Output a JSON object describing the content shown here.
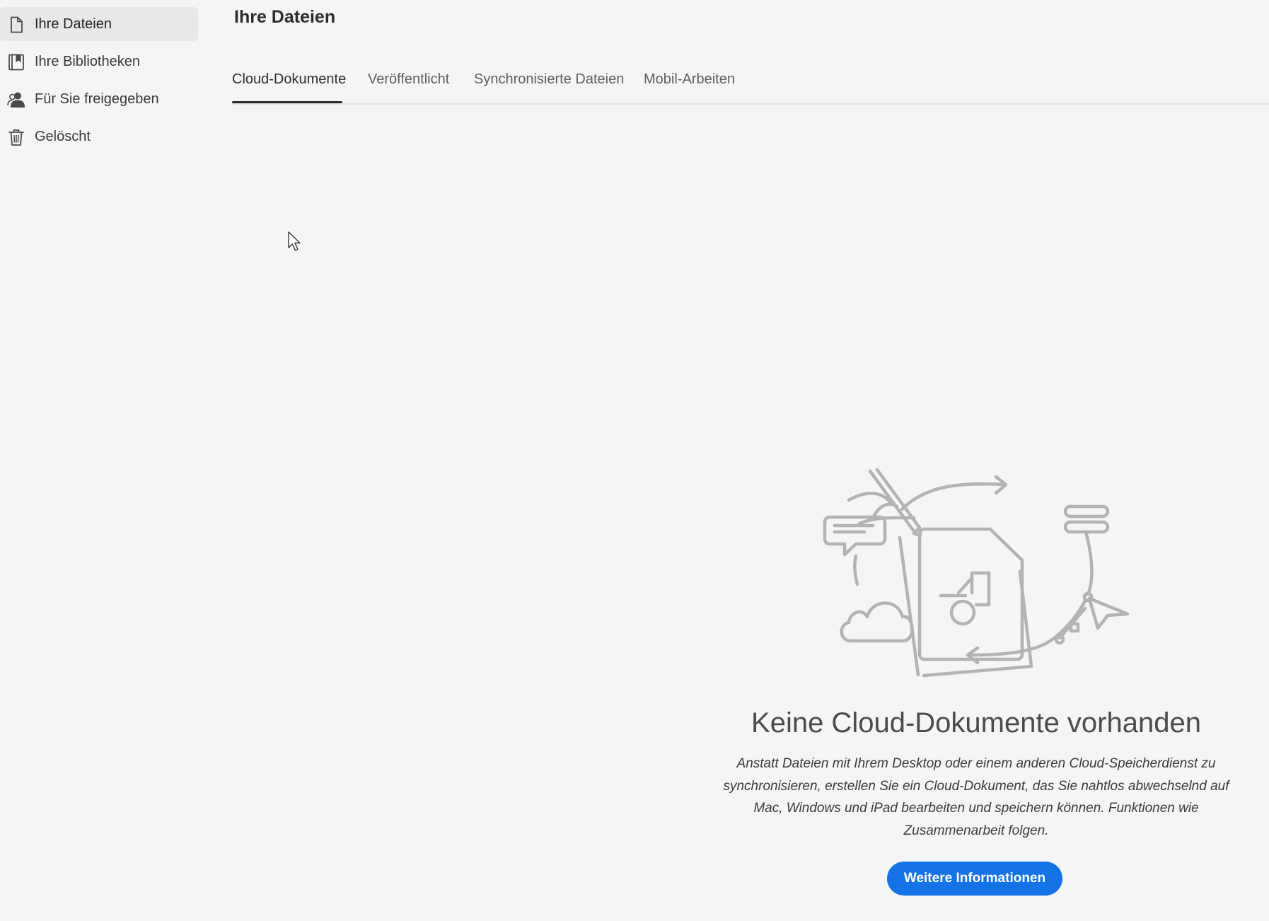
{
  "page": {
    "title": "Ihre Dateien"
  },
  "sidebar": {
    "items": [
      {
        "label": "Ihre Dateien",
        "icon": "file-icon",
        "active": true
      },
      {
        "label": "Ihre Bibliotheken",
        "icon": "library-icon",
        "active": false
      },
      {
        "label": "Für Sie freigegeben",
        "icon": "shared-users-icon",
        "active": false
      },
      {
        "label": "Gelöscht",
        "icon": "trash-icon",
        "active": false
      }
    ]
  },
  "tabs": [
    {
      "label": "Cloud-Dokumente",
      "active": true
    },
    {
      "label": "Veröffentlicht",
      "active": false
    },
    {
      "label": "Synchronisierte Dateien",
      "active": false
    },
    {
      "label": "Mobil-Arbeiten",
      "active": false
    }
  ],
  "empty_state": {
    "illustration": "cloud-documents-illustration",
    "title": "Keine Cloud-Dokumente vorhanden",
    "description": "Anstatt Dateien mit Ihrem Desktop oder einem anderen Cloud-Speicherdienst zu synchronisieren, erstellen Sie ein Cloud-Dokument, das Sie nahtlos abwechselnd auf Mac, Windows und iPad bearbeiten und speichern können. Funktionen wie Zusammenarbeit folgen.",
    "button_label": "Weitere Informationen"
  },
  "colors": {
    "background": "#f5f5f5",
    "active_item_bg": "#e8e8e8",
    "accent": "#1473e6",
    "illustration_stroke": "#b3b3b3"
  }
}
